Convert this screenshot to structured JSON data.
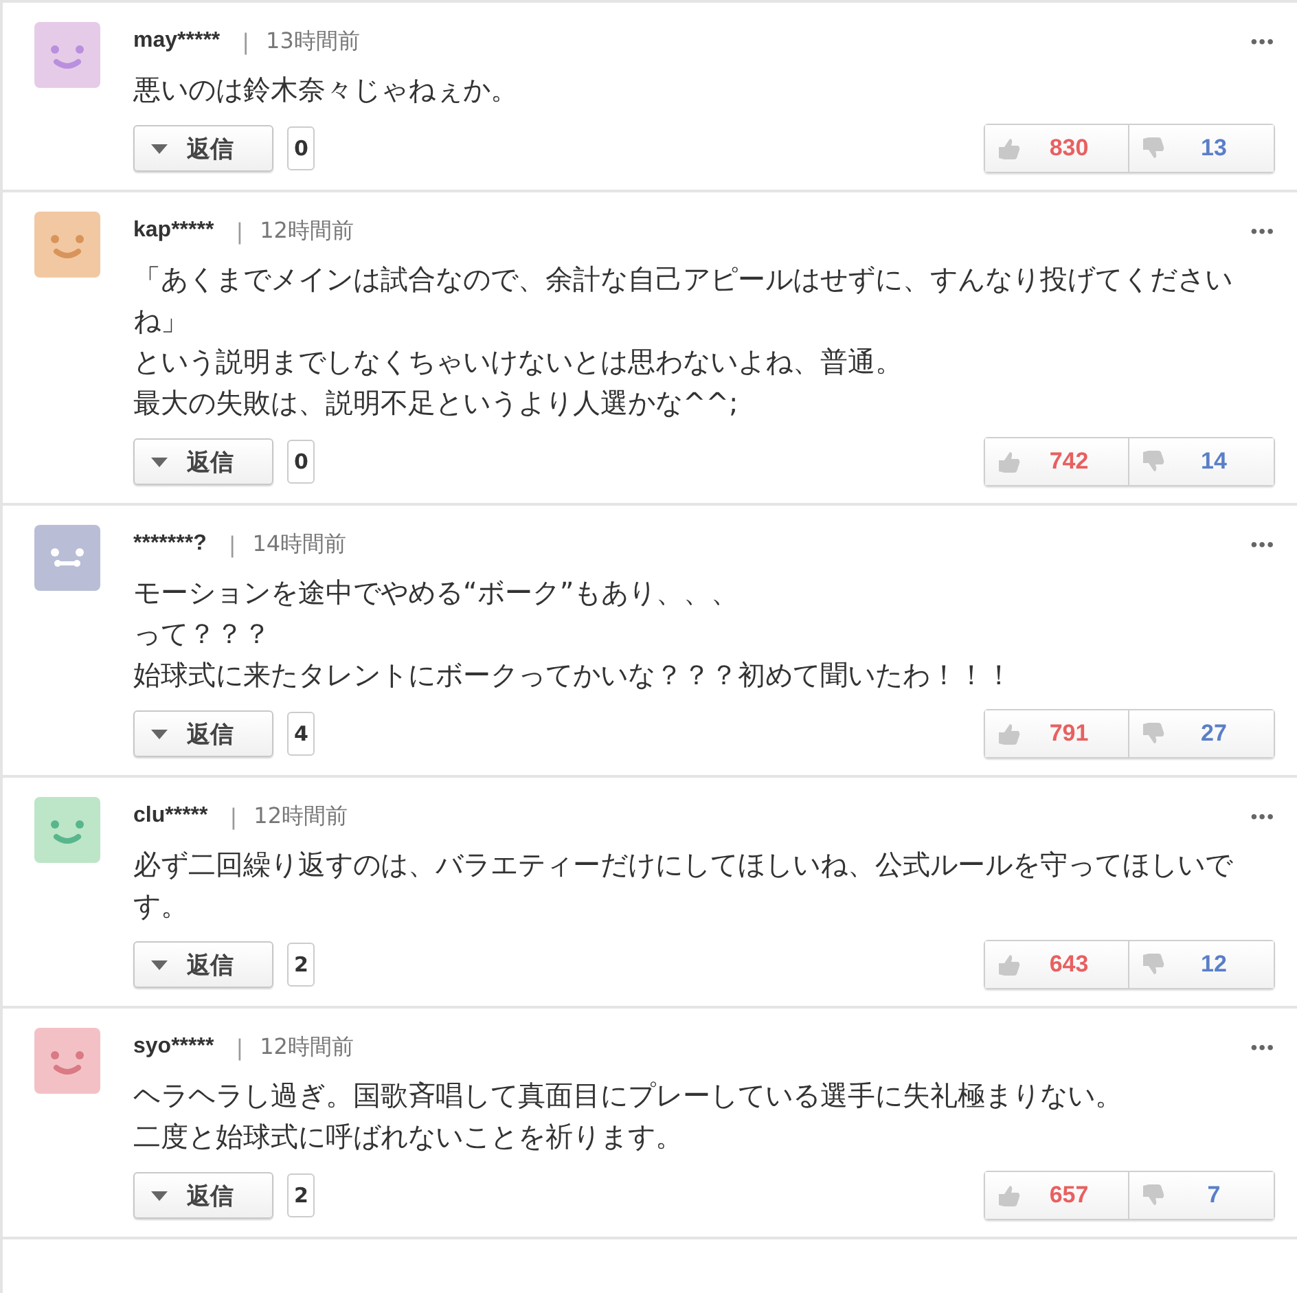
{
  "comments": [
    {
      "avatar": {
        "kind": "smile",
        "color": "#e6cbe8"
      },
      "user": "may*****",
      "separator": "|",
      "time": "13時間前",
      "menu": "•••",
      "lines": [
        "悪いのは鈴木奈々じゃねぇか。"
      ],
      "reply": {
        "label": "返信",
        "count": "0"
      },
      "likes": "830",
      "dislikes": "13"
    },
    {
      "avatar": {
        "kind": "smile",
        "color": "#f2c8a2"
      },
      "user": "kap*****",
      "separator": "|",
      "time": "12時間前",
      "menu": "•••",
      "lines": [
        "「あくまでメインは試合なので、余計な自己アピールはせずに、すんなり投げてくださいね」",
        "という説明までしなくちゃいけないとは思わないよね、普通。",
        "最大の失敗は、説明不足というより人選かな^^;"
      ],
      "reply": {
        "label": "返信",
        "count": "0"
      },
      "likes": "742",
      "dislikes": "14"
    },
    {
      "avatar": {
        "kind": "teeth",
        "color": "#b9bed6"
      },
      "user": "*******?",
      "separator": "|",
      "time": "14時間前",
      "menu": "•••",
      "lines": [
        "モーションを途中でやめる“ボーク”もあり、、、",
        "って？？？",
        "始球式に来たタレントにボークってかいな？？？初めて聞いたわ！！！"
      ],
      "reply": {
        "label": "返信",
        "count": "4"
      },
      "likes": "791",
      "dislikes": "27"
    },
    {
      "avatar": {
        "kind": "smile",
        "color": "#bde5c8"
      },
      "user": "clu*****",
      "separator": "|",
      "time": "12時間前",
      "menu": "•••",
      "lines": [
        "必ず二回繰り返すのは、バラエティーだけにしてほしいね、公式ルールを守ってほしいです。"
      ],
      "reply": {
        "label": "返信",
        "count": "2"
      },
      "likes": "643",
      "dislikes": "12"
    },
    {
      "avatar": {
        "kind": "smile",
        "color": "#f3c1c5"
      },
      "user": "syo*****",
      "separator": "|",
      "time": "12時間前",
      "menu": "•••",
      "lines": [
        "ヘラヘラし過ぎ。国歌斉唱して真面目にプレーしている選手に失礼極まりない。",
        "二度と始球式に呼ばれないことを祈ります。"
      ],
      "reply": {
        "label": "返信",
        "count": "2"
      },
      "likes": "657",
      "dislikes": "7"
    }
  ]
}
